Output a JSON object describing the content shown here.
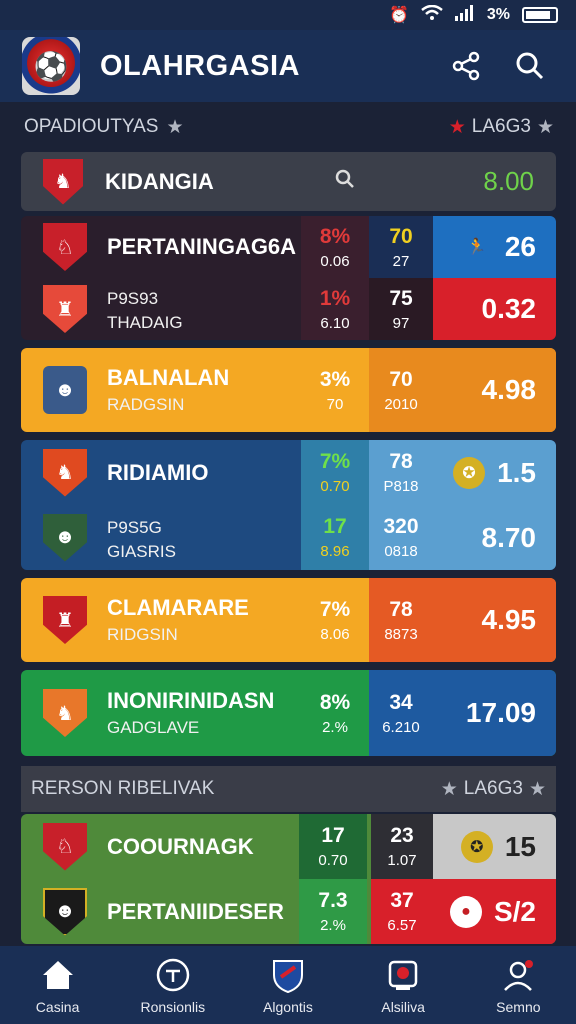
{
  "status_bar": {
    "alarm_icon": "alarm-icon",
    "wifi_icon": "wifi-icon",
    "signal_icon": "signal-icon",
    "battery_text": "3%",
    "battery_icon": "battery-icon"
  },
  "app_bar": {
    "title": "OLAHRGASIA",
    "logo_icon": "club-logo",
    "share_icon": "share-icon",
    "search_icon": "search-icon"
  },
  "section1": {
    "left": "OPADIOUTYAS",
    "right": "LA6G3"
  },
  "search_card": {
    "title": "KIDANGIA",
    "value": "8.00"
  },
  "cards": [
    {
      "bg": "#2a1e2c",
      "rows": [
        {
          "name1": "PERTANINGAG6A",
          "name2": "",
          "c1a": "8%",
          "c1b": "0.06",
          "c2a": "70",
          "c2b": "27",
          "score": "26",
          "crest": "#c8202a"
        },
        {
          "name1": "P9S93",
          "name2": "THADAIG",
          "c1a": "1%",
          "c1b": "6.10",
          "c2a": "75",
          "c2b": "97",
          "score": "0.32",
          "crest": "#e64a3a"
        }
      ]
    },
    {
      "bg": "#f4a823",
      "rows": [
        {
          "name1": "BALNALAN",
          "name2": "RADGSIN",
          "c1a": "3%",
          "c1b": "70",
          "c2a": "70",
          "c2b": "2010",
          "score": "4.98",
          "crest": "#3a5a8a"
        }
      ]
    },
    {
      "bg": "#1e4a80",
      "rows": [
        {
          "name1": "RIDIAMIO",
          "name2": "",
          "c1a": "7%",
          "c1b": "0.70",
          "c2a": "78",
          "c2b": "P818",
          "score": "1.5",
          "crest": "#e04a20"
        },
        {
          "name1": "P9S5G",
          "name2": "GIASRIS",
          "c1a": "17",
          "c1b": "8.96",
          "c2a": "320",
          "c2b": "0818",
          "score": "8.70",
          "crest": "#2f5f3a"
        }
      ]
    },
    {
      "bg": "#f4a823",
      "rows": [
        {
          "name1": "CLAMARARE",
          "name2": "RIDGSIN",
          "c1a": "7%",
          "c1b": "8.06",
          "c2a": "78",
          "c2b": "8873",
          "score": "4.95",
          "crest": "#c41e24"
        }
      ]
    },
    {
      "bg": "#1f9a46",
      "rows": [
        {
          "name1": "INONIRINIDASN",
          "name2": "GADGLAVE",
          "c1a": "8%",
          "c1b": "2.%",
          "c2a": "34",
          "c2b": "6.210",
          "score": "17.09",
          "crest": "#e8772a"
        }
      ]
    }
  ],
  "section2": {
    "left": "RERSON RIBELIVAK",
    "right": "LA6G3"
  },
  "card_last": {
    "rows": [
      {
        "name1": "COOURNAGK",
        "name2": "",
        "c1a": "17",
        "c1b": "0.70",
        "c2a": "23",
        "c2b": "1.07",
        "score": "15",
        "crest": "#c8202a"
      },
      {
        "name1": "PERTANIIDESER",
        "name2": "",
        "c1a": "7.3",
        "c1b": "2.%",
        "c2a": "37",
        "c2b": "6.57",
        "score": "S/2",
        "crest": "#1a1a1a"
      }
    ]
  },
  "bottom_nav": [
    {
      "label": "Casina",
      "icon": "home-icon"
    },
    {
      "label": "Ronsionlis",
      "icon": "ticket-icon"
    },
    {
      "label": "Algontis",
      "icon": "shield-icon"
    },
    {
      "label": "Alsiliva",
      "icon": "trophy-icon"
    },
    {
      "label": "Semno",
      "icon": "profile-icon"
    }
  ]
}
